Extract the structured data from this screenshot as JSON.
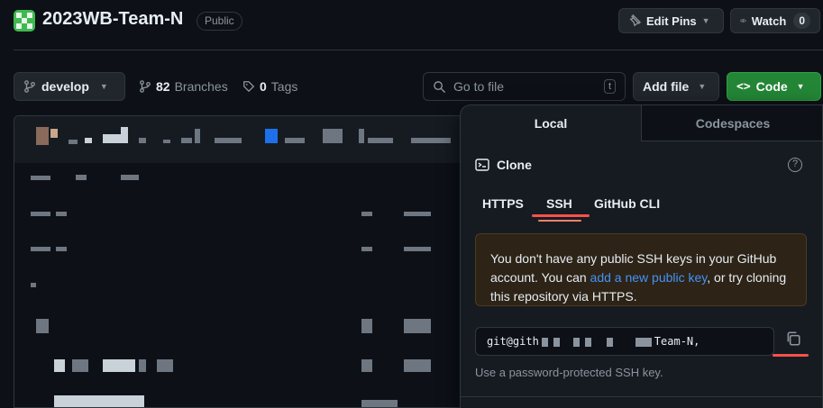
{
  "repo": {
    "name": "2023WB-Team-N",
    "visibility": "Public"
  },
  "header_actions": {
    "edit_pins": "Edit Pins",
    "watch": "Watch",
    "watch_count": "0"
  },
  "toolbar": {
    "branch": "develop",
    "branches_count": "82",
    "branches_label": "Branches",
    "tags_count": "0",
    "tags_label": "Tags",
    "goto_placeholder": "Go to file",
    "goto_shortcut": "t",
    "add_file": "Add file",
    "code": "Code"
  },
  "code_dropdown": {
    "tabs": [
      "Local",
      "Codespaces"
    ],
    "active_tab": "Local",
    "clone_label": "Clone",
    "protocols": [
      "HTTPS",
      "SSH",
      "GitHub CLI"
    ],
    "active_protocol": "SSH",
    "warning": {
      "text_1": "You don't have any public SSH keys in your GitHub account. You can ",
      "link": "add a new public key",
      "text_2": ", or try cloning this repository via HTTPS."
    },
    "url_start": "git@gith",
    "url_end": "Team-N,",
    "hint": "Use a password-protected SSH key."
  },
  "colors": {
    "accent_green": "#238636",
    "link_blue": "#4493f8",
    "annotation_red": "#f85149"
  },
  "icons": {
    "repo_logo": "identicon",
    "branch": "git-branch-icon",
    "tag": "tag-icon",
    "search": "search-icon",
    "terminal": "terminal-icon",
    "help": "question-icon",
    "copy": "copy-icon",
    "eye": "eye-icon",
    "pin": "pin-icon"
  }
}
